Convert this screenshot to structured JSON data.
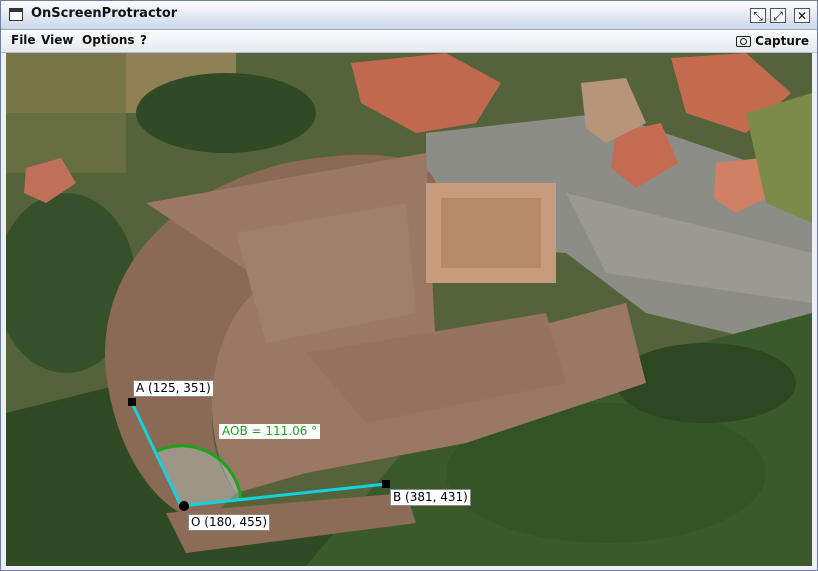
{
  "window": {
    "title": "OnScreenProtractor"
  },
  "window_buttons": {
    "restore": "⤡",
    "maximize": "⤢",
    "close": "✕"
  },
  "menu": {
    "items": [
      "File",
      "View",
      "Options",
      "?"
    ],
    "capture_label": "Capture"
  },
  "protractor": {
    "point_a": {
      "label": "A (125, 351)"
    },
    "point_b": {
      "label": "B (381, 431)"
    },
    "point_o": {
      "label": "O (180, 455)"
    },
    "angle": {
      "label": "AOB = 111.06 °"
    },
    "colors": {
      "ray": "#14d2dc",
      "arc": "#1aa51a",
      "handle": "#000000"
    }
  },
  "icons": [
    "window-icon",
    "restore-icon",
    "maximize-icon",
    "close-icon",
    "camera-icon"
  ]
}
